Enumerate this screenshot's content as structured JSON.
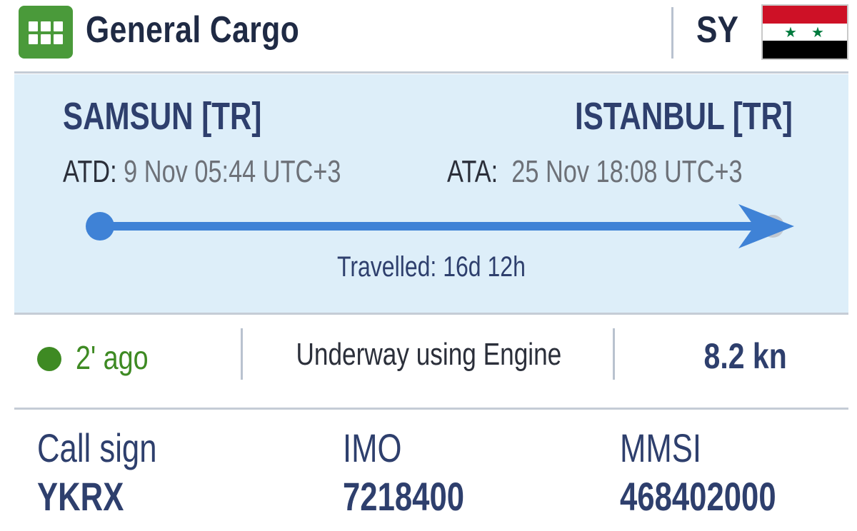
{
  "header": {
    "title": "General Cargo",
    "category_icon": "grid-icon",
    "flag_code": "SY",
    "flag_colors": [
      "#ce1126",
      "#ffffff",
      "#000000"
    ],
    "flag_star_color": "#007a3d",
    "flag_star_glyph": "★"
  },
  "voyage": {
    "departure_port": "SAMSUN [TR]",
    "arrival_port": "ISTANBUL [TR]",
    "atd_label": "ATD:",
    "atd_value": "9 Nov 05:44 UTC+3",
    "ata_label": "ATA:",
    "ata_value": "25 Nov 18:08 UTC+3",
    "travelled": "Travelled: 16d 12h",
    "progress_percent": 100,
    "track_color": "#3f82d6"
  },
  "status": {
    "last_seen": "2' ago",
    "last_seen_color": "#3e8a23",
    "navigational_status": "Underway using Engine",
    "speed": "8.2 kn"
  },
  "identifiers": {
    "call_sign_label": "Call sign",
    "call_sign_value": "YKRX",
    "imo_label": "IMO",
    "imo_value": "7218400",
    "mmsi_label": "MMSI",
    "mmsi_value": "468402000"
  }
}
